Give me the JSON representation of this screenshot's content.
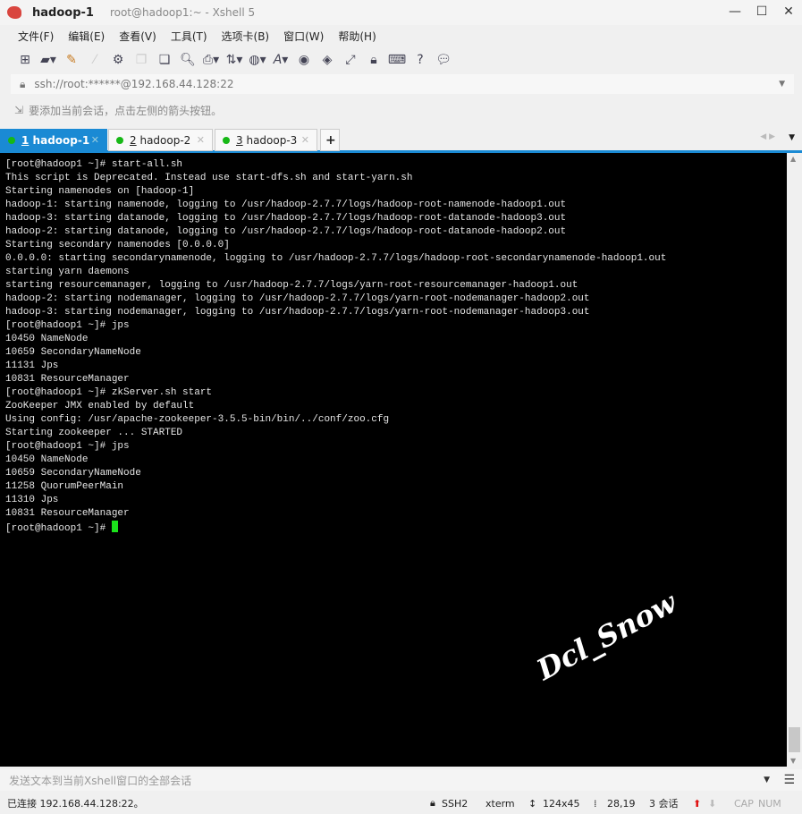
{
  "window": {
    "title": "hadoop-1",
    "subtitle": "root@hadoop1:~ - Xshell 5"
  },
  "menu": [
    "文件(F)",
    "编辑(E)",
    "查看(V)",
    "工具(T)",
    "选项卡(B)",
    "窗口(W)",
    "帮助(H)"
  ],
  "toolbar_icons": [
    "new-session-icon",
    "open-folder-icon",
    "connect-icon",
    "disconnect-icon",
    "properties-icon",
    "copy-icon",
    "paste-icon",
    "find-icon",
    "print-icon",
    "transfer-icon",
    "globe-icon",
    "font-icon",
    "xftp-icon",
    "xmanager-icon",
    "fullscreen-icon",
    "lock-icon",
    "keyboard-icon",
    "help-icon",
    "chat-icon"
  ],
  "address": "ssh://root:******@192.168.44.128:22",
  "hint": "要添加当前会话，点击左侧的箭头按钮。",
  "tabs": [
    {
      "num": "1",
      "label": "hadoop-1"
    },
    {
      "num": "2",
      "label": "hadoop-2"
    },
    {
      "num": "3",
      "label": "hadoop-3"
    }
  ],
  "terminal": {
    "lines": [
      "[root@hadoop1 ~]# start-all.sh",
      "This script is Deprecated. Instead use start-dfs.sh and start-yarn.sh",
      "Starting namenodes on [hadoop-1]",
      "hadoop-1: starting namenode, logging to /usr/hadoop-2.7.7/logs/hadoop-root-namenode-hadoop1.out",
      "hadoop-3: starting datanode, logging to /usr/hadoop-2.7.7/logs/hadoop-root-datanode-hadoop3.out",
      "hadoop-2: starting datanode, logging to /usr/hadoop-2.7.7/logs/hadoop-root-datanode-hadoop2.out",
      "Starting secondary namenodes [0.0.0.0]",
      "0.0.0.0: starting secondarynamenode, logging to /usr/hadoop-2.7.7/logs/hadoop-root-secondarynamenode-hadoop1.out",
      "starting yarn daemons",
      "starting resourcemanager, logging to /usr/hadoop-2.7.7/logs/yarn-root-resourcemanager-hadoop1.out",
      "hadoop-2: starting nodemanager, logging to /usr/hadoop-2.7.7/logs/yarn-root-nodemanager-hadoop2.out",
      "hadoop-3: starting nodemanager, logging to /usr/hadoop-2.7.7/logs/yarn-root-nodemanager-hadoop3.out",
      "[root@hadoop1 ~]# jps",
      "10450 NameNode",
      "10659 SecondaryNameNode",
      "11131 Jps",
      "10831 ResourceManager",
      "[root@hadoop1 ~]# zkServer.sh start",
      "ZooKeeper JMX enabled by default",
      "Using config: /usr/apache-zookeeper-3.5.5-bin/bin/../conf/zoo.cfg",
      "Starting zookeeper ... STARTED",
      "[root@hadoop1 ~]# jps",
      "10450 NameNode",
      "10659 SecondaryNameNode",
      "11258 QuorumPeerMain",
      "11310 Jps",
      "10831 ResourceManager"
    ],
    "prompt": "[root@hadoop1 ~]# "
  },
  "watermark": "Dcl_Snow",
  "send_bar": {
    "placeholder": "发送文本到当前Xshell窗口的全部会话"
  },
  "status": {
    "connected": "已连接 192.168.44.128:22。",
    "protocol": "SSH2",
    "term": "xterm",
    "size": "124x45",
    "cursor": "28,19",
    "sessions": "3 会话",
    "caps": "CAP",
    "num": "NUM"
  }
}
